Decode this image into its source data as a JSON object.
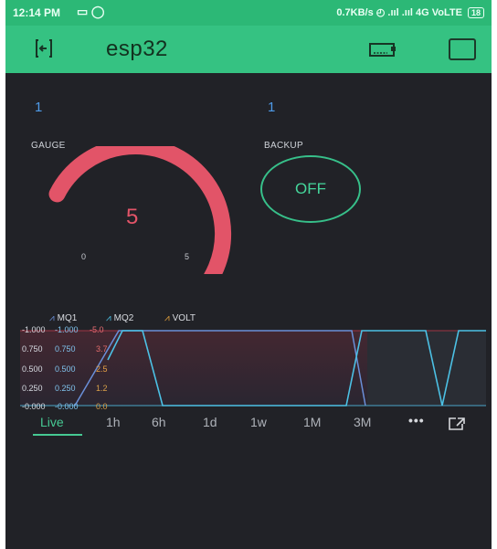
{
  "status_bar": {
    "time": "12:14 PM",
    "right_text": "0.7KB/s ◴ .ııl .ııl 4G VoLTE",
    "battery": "18"
  },
  "app_bar": {
    "title": "esp32",
    "background_color": "#35c282"
  },
  "widgets": {
    "gauge": {
      "top_value": "1",
      "label": "GAUGE",
      "value": "5",
      "min": "0",
      "max": "5",
      "fill_fraction": 1.0,
      "color": "#e25468"
    },
    "backup": {
      "top_value": "1",
      "label": "BACKUP",
      "button_text": "OFF",
      "color": "#37c08a"
    }
  },
  "chart": {
    "legend": [
      {
        "name": "MQ1",
        "color": "#6a8fd8"
      },
      {
        "name": "MQ2",
        "color": "#4cc1e5"
      },
      {
        "name": "VOLT",
        "color": "#e6a23c"
      }
    ],
    "y_axis_1": [
      "-1.000",
      "0.750",
      "0.500",
      "0.250",
      "-0.000"
    ],
    "y_axis_2": [
      "-1.000",
      "0.750",
      "0.500",
      "0.250",
      "-0.000"
    ],
    "y_axis_3": [
      "-5.0",
      "3.7",
      "2.5",
      "1.2",
      "0.0"
    ],
    "periods": [
      "Live",
      "1h",
      "6h",
      "1d",
      "1w",
      "1M",
      "3M"
    ],
    "active_period": "Live",
    "more_label": "•••"
  }
}
